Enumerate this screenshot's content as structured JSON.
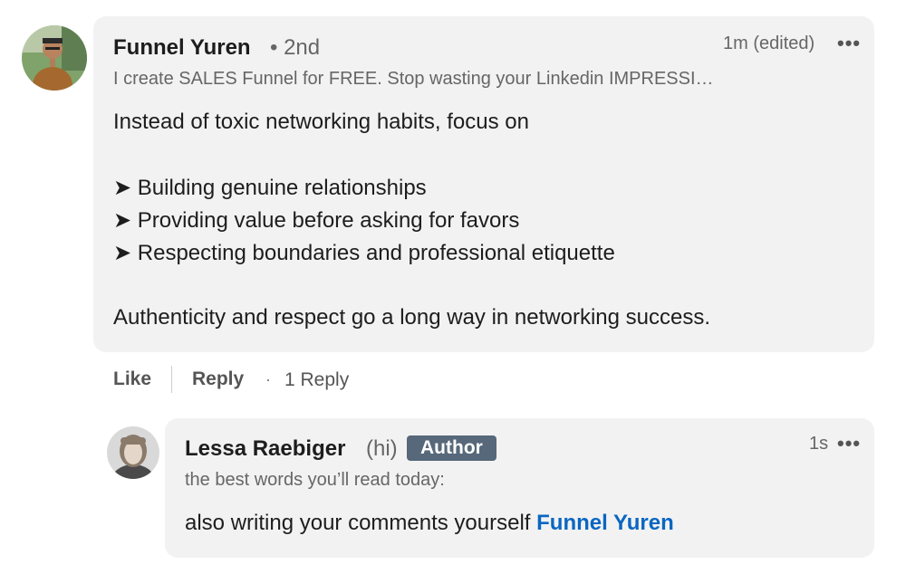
{
  "comment": {
    "author": "Funnel Yuren",
    "degree": "• 2nd",
    "headline": "I create SALES Funnel for FREE. Stop wasting your Linkedin IMPRESSI…",
    "time": "1m (edited)",
    "more_icon": "•••",
    "body": {
      "intro": "Instead of toxic networking habits, focus on",
      "bullets": [
        "➤ Building genuine relationships",
        "➤ Providing value before asking for favors",
        "➤ Respecting boundaries and professional etiquette"
      ],
      "closing": "Authenticity and respect go a long way in networking success."
    },
    "actions": {
      "like": "Like",
      "reply": "Reply",
      "dot": "·",
      "reply_count": "1 Reply"
    }
  },
  "reply": {
    "author": "Lessa Raebiger",
    "pronoun": "(hi)",
    "badge": "Author",
    "headline": "the best words you’ll read today:",
    "time": "1s",
    "more_icon": "•••",
    "body_text": "also writing your comments yourself ",
    "mention": "Funnel Yuren"
  },
  "colors": {
    "bubble": "#f2f2f2",
    "mention": "#0a66c2",
    "badge": "#56687a"
  }
}
